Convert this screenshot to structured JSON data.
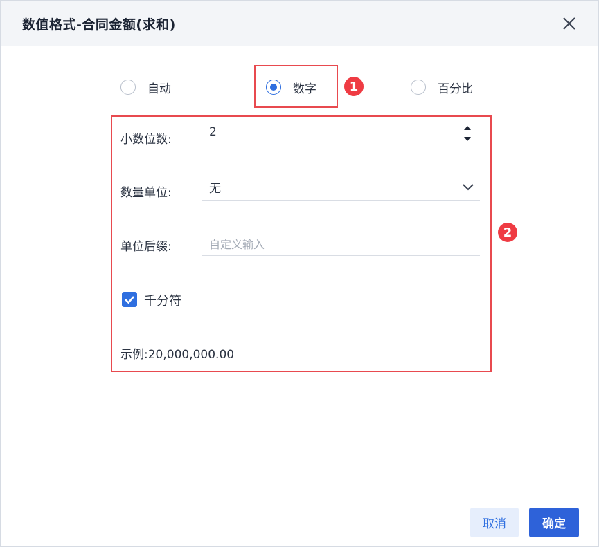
{
  "dialog": {
    "title": "数值格式-合同金额(求和)"
  },
  "format_options": [
    {
      "label": "自动",
      "checked": false
    },
    {
      "label": "数字",
      "checked": true
    },
    {
      "label": "百分比",
      "checked": false
    }
  ],
  "badges": {
    "one": "1",
    "two": "2"
  },
  "form": {
    "decimal_label": "小数位数:",
    "decimal_value": "2",
    "unit_label": "数量单位:",
    "unit_value": "无",
    "suffix_label": "单位后缀:",
    "suffix_placeholder": "自定义输入",
    "thousands_label": "千分符",
    "thousands_checked": true,
    "example_text": "示例:20,000,000.00"
  },
  "buttons": {
    "cancel": "取消",
    "ok": "确定"
  },
  "colors": {
    "accent": "#2f6fe0",
    "annotation": "#e84a4f",
    "header_bg": "#f3f5f8"
  }
}
